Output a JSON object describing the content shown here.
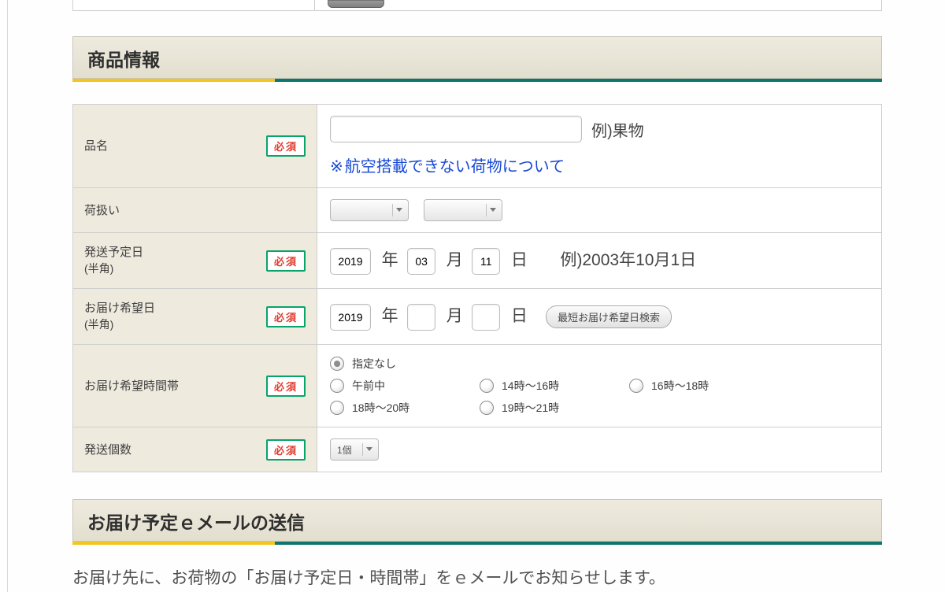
{
  "required_label": "必須",
  "section1": {
    "title": "商品情報"
  },
  "rows": {
    "item_name": {
      "label": "品名",
      "example": "例)果物",
      "input_value": "",
      "note_prefix": "※",
      "note_link": "航空搭載できない荷物について"
    },
    "handling": {
      "label": "荷扱い"
    },
    "ship_date": {
      "label": "発送予定日",
      "sub": "(半角)",
      "year": "2019",
      "month": "03",
      "day": "11",
      "unit_year": "年",
      "unit_month": "月",
      "unit_day": "日",
      "example": "例)2003年10月1日"
    },
    "deliver_date": {
      "label": "お届け希望日",
      "sub": "(半角)",
      "year": "2019",
      "month": "",
      "day": "",
      "unit_year": "年",
      "unit_month": "月",
      "unit_day": "日",
      "lookup_btn": "最短お届け希望日検索"
    },
    "deliver_time": {
      "label": "お届け希望時間帯",
      "options": {
        "o1": "指定なし",
        "o2": "午前中",
        "o3": "14時～16時",
        "o4": "16時～18時",
        "o5": "18時～20時",
        "o6": "19時～21時"
      },
      "selected": "o1"
    },
    "quantity": {
      "label": "発送個数",
      "value": "1個"
    }
  },
  "section2": {
    "title": "お届け予定ｅメールの送信"
  },
  "bottom_teaser": "お届け先に、お荷物の「お届け予定日・時間帯」をｅメールでお知らせします。"
}
